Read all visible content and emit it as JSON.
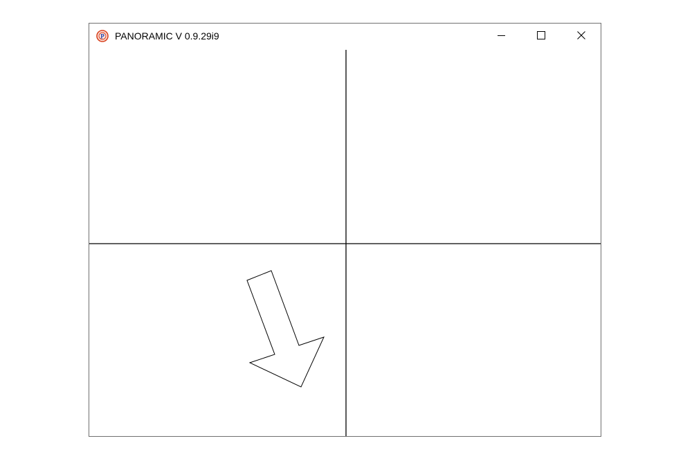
{
  "window": {
    "title": "PANORAMIC V 0.9.29i9",
    "app_icon": "panoramic-logo-icon",
    "controls": {
      "minimize_icon": "minimize-icon",
      "maximize_icon": "maximize-icon",
      "close_icon": "close-icon"
    }
  },
  "canvas": {
    "background": "#ffffff",
    "line_color": "#000000",
    "quadrants": 4,
    "shape": "arrow-down-right-outline"
  }
}
